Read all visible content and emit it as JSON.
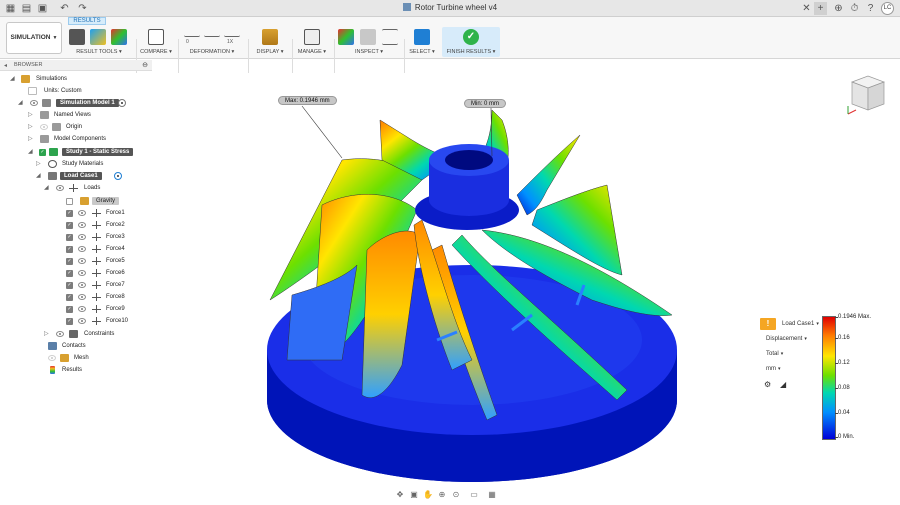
{
  "window": {
    "title": "Rotor Turbine wheel v4",
    "avatar_initials": "LC"
  },
  "ribbon": {
    "workspace_label": "SIMULATION",
    "active_tab": "RESULTS",
    "groups": [
      {
        "label": "RESULT TOOLS ▾"
      },
      {
        "label": "COMPARE ▾"
      },
      {
        "label": "DEFORMATION ▾"
      },
      {
        "label": "DISPLAY ▾"
      },
      {
        "label": "MANAGE ▾"
      },
      {
        "label": "INSPECT ▾"
      },
      {
        "label": "SELECT ▾"
      },
      {
        "label": "FINISH RESULTS ▾"
      }
    ],
    "deformation_values": [
      "0",
      "1X"
    ]
  },
  "browser": {
    "title": "BROWSER",
    "items": [
      {
        "label": "Simulations"
      },
      {
        "label": "Units: Custom"
      },
      {
        "label": "Simulation Model 1"
      },
      {
        "label": "Named Views"
      },
      {
        "label": "Origin"
      },
      {
        "label": "Model Components"
      },
      {
        "label": "Study 1 - Static Stress"
      },
      {
        "label": "Study Materials"
      },
      {
        "label": "Load Case1"
      },
      {
        "label": "Loads"
      },
      {
        "label": "Gravity"
      },
      {
        "label": "Force1"
      },
      {
        "label": "Force2"
      },
      {
        "label": "Force3"
      },
      {
        "label": "Force4"
      },
      {
        "label": "Force5"
      },
      {
        "label": "Force6"
      },
      {
        "label": "Force7"
      },
      {
        "label": "Force8"
      },
      {
        "label": "Force9"
      },
      {
        "label": "Force10"
      },
      {
        "label": "Constraints"
      },
      {
        "label": "Contacts"
      },
      {
        "label": "Mesh"
      },
      {
        "label": "Results"
      }
    ]
  },
  "viewport": {
    "max_probe": "Max: 0.1946 mm",
    "min_probe": "Min: 0 mm"
  },
  "legend": {
    "load_case": "Load Case1",
    "result_type": "Displacement",
    "component": "Total",
    "unit": "mm",
    "ticks": [
      "0.1946 Max.",
      "0.16",
      "0.12",
      "0.08",
      "0.04",
      "0 Min."
    ],
    "colors": {
      "max": "#e00000",
      "min": "#0000d8"
    }
  }
}
